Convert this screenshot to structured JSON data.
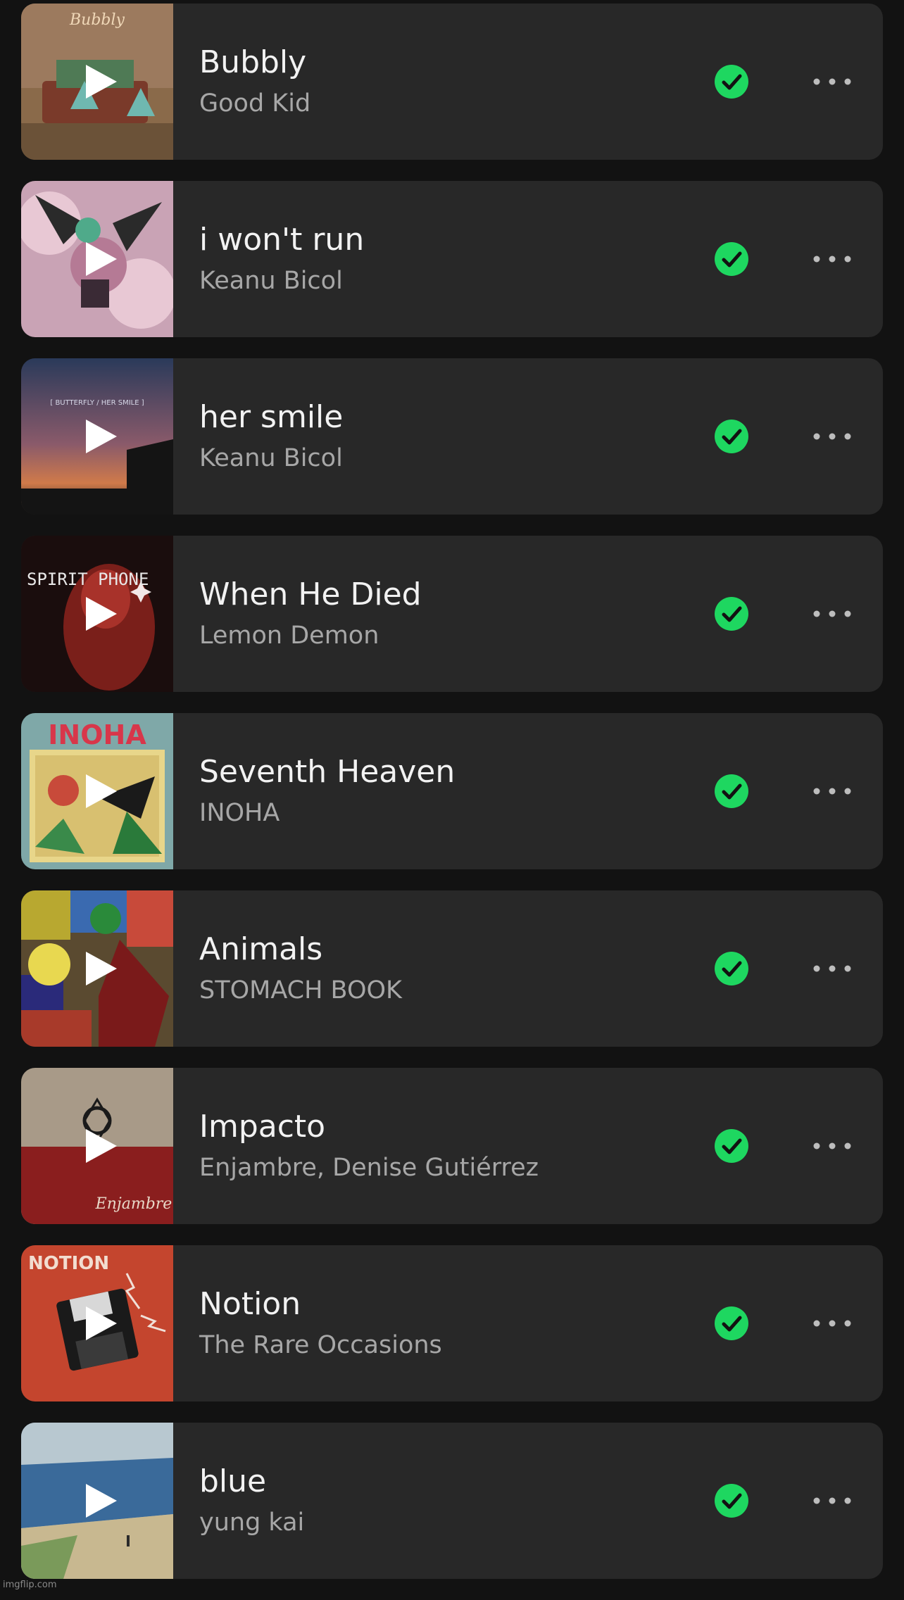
{
  "colors": {
    "background": "#121212",
    "card": "#282828",
    "title_text": "#f2f2f2",
    "artist_text": "#a7a7a7",
    "saved_green": "#1ed760"
  },
  "tracks": [
    {
      "title": "Bubbly",
      "artist": "Good Kid",
      "saved": true,
      "cover_label": "Bubbly"
    },
    {
      "title": "i won't run",
      "artist": "Keanu Bicol",
      "saved": true,
      "cover_label": ""
    },
    {
      "title": "her smile",
      "artist": "Keanu Bicol",
      "saved": true,
      "cover_label": "[ BUTTERFLY / HER SMILE ]"
    },
    {
      "title": "When He Died",
      "artist": "Lemon Demon",
      "saved": true,
      "cover_label": "SPIRIT PHONE"
    },
    {
      "title": "Seventh Heaven",
      "artist": "INOHA",
      "saved": true,
      "cover_label": "INOHA"
    },
    {
      "title": "Animals",
      "artist": "STOMACH BOOK",
      "saved": true,
      "cover_label": ""
    },
    {
      "title": "Impacto",
      "artist": "Enjambre, Denise Gutiérrez",
      "saved": true,
      "cover_label": "Enjambre"
    },
    {
      "title": "Notion",
      "artist": "The Rare Occasions",
      "saved": true,
      "cover_label": "NOTION"
    },
    {
      "title": "blue",
      "artist": "yung kai",
      "saved": true,
      "cover_label": ""
    }
  ],
  "watermark": "imgflip.com"
}
